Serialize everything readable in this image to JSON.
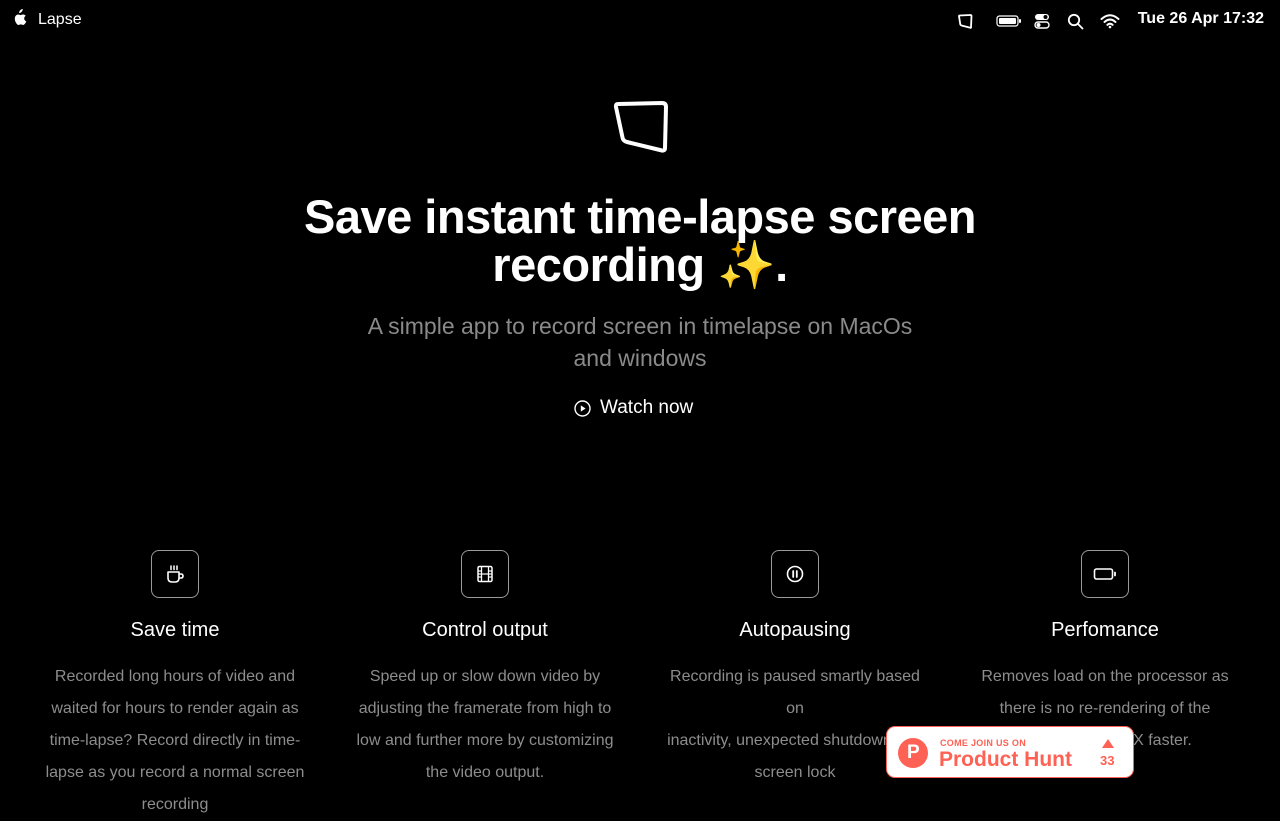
{
  "menubar": {
    "app_name": "Lapse",
    "clock": "Tue 26 Apr 17:32",
    "icons": [
      "apple-logo",
      "lapse-icon",
      "battery-icon",
      "control-center-icon",
      "search-icon",
      "wifi-icon"
    ]
  },
  "hero": {
    "headline_line1": "Save instant time-lapse screen",
    "headline_line2": "recording ✨.",
    "subtitle_line1": "A simple app to record screen in timelapse on MacOs",
    "subtitle_line2": "and windows",
    "watch_label": "Watch now"
  },
  "features": [
    {
      "icon": "coffee-cup-icon",
      "title": "Save time",
      "desc_lines": [
        "Recorded long hours of video and",
        "waited for hours to render again as",
        "time-lapse? Record directly in time-",
        "lapse as you record a normal screen",
        "recording"
      ]
    },
    {
      "icon": "film-icon",
      "title": "Control output",
      "desc_lines": [
        "Speed up or slow down video by",
        "adjusting the framerate from high to",
        "low and further more by customizing",
        "the video output."
      ]
    },
    {
      "icon": "pause-circle-icon",
      "title": "Autopausing",
      "desc_lines": [
        "Recording is paused smartly based on",
        "inactivity, unexpected shutdown and",
        "screen lock"
      ]
    },
    {
      "icon": "battery-outline-icon",
      "title": "Perfomance",
      "desc_lines": [
        "Removes load on the processor as",
        "there is no re-rendering of the",
        "is 5X faster."
      ]
    }
  ],
  "product_hunt": {
    "small_text": "COME JOIN US ON",
    "big_text": "Product Hunt",
    "upvotes": "33",
    "logo_letter": "P"
  },
  "colors": {
    "background": "#000000",
    "text": "#ffffff",
    "muted": "#8a8a8a",
    "product_hunt": "#ff6154"
  }
}
